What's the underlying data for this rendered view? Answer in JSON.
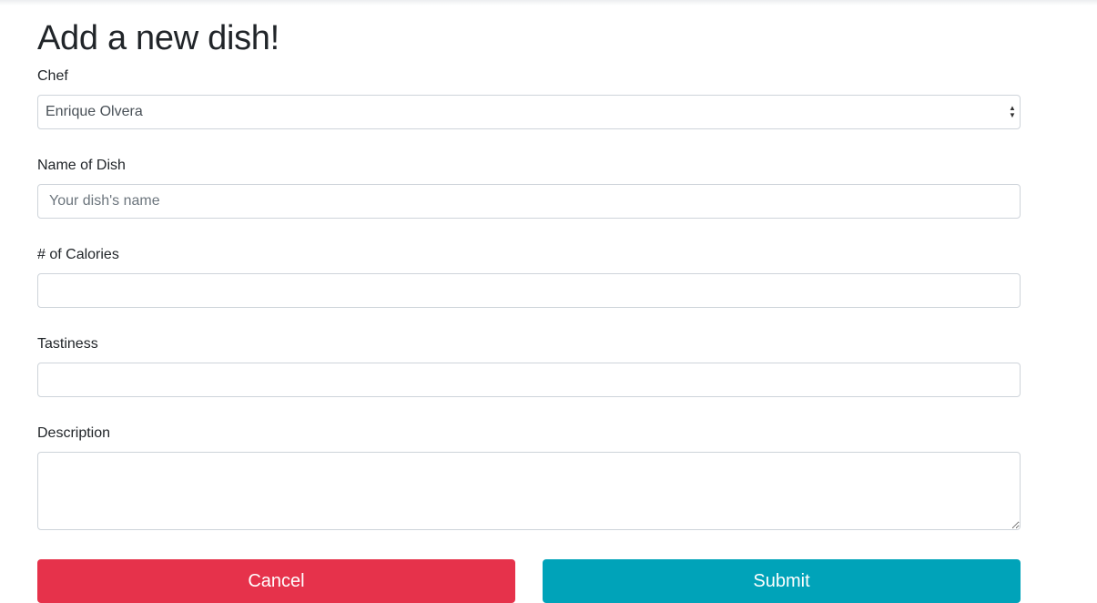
{
  "page": {
    "title": "Add a new dish!"
  },
  "form": {
    "chef": {
      "label": "Chef",
      "selected": "Enrique Olvera"
    },
    "dish_name": {
      "label": "Name of Dish",
      "placeholder": "Your dish's name",
      "value": ""
    },
    "calories": {
      "label": "# of Calories",
      "value": ""
    },
    "tastiness": {
      "label": "Tastiness",
      "value": ""
    },
    "description": {
      "label": "Description",
      "value": ""
    }
  },
  "buttons": {
    "cancel_label": "Cancel",
    "submit_label": "Submit"
  },
  "colors": {
    "cancel": "#e6324b",
    "submit": "#00a3b9",
    "border": "#ced4da",
    "text": "#212529"
  }
}
